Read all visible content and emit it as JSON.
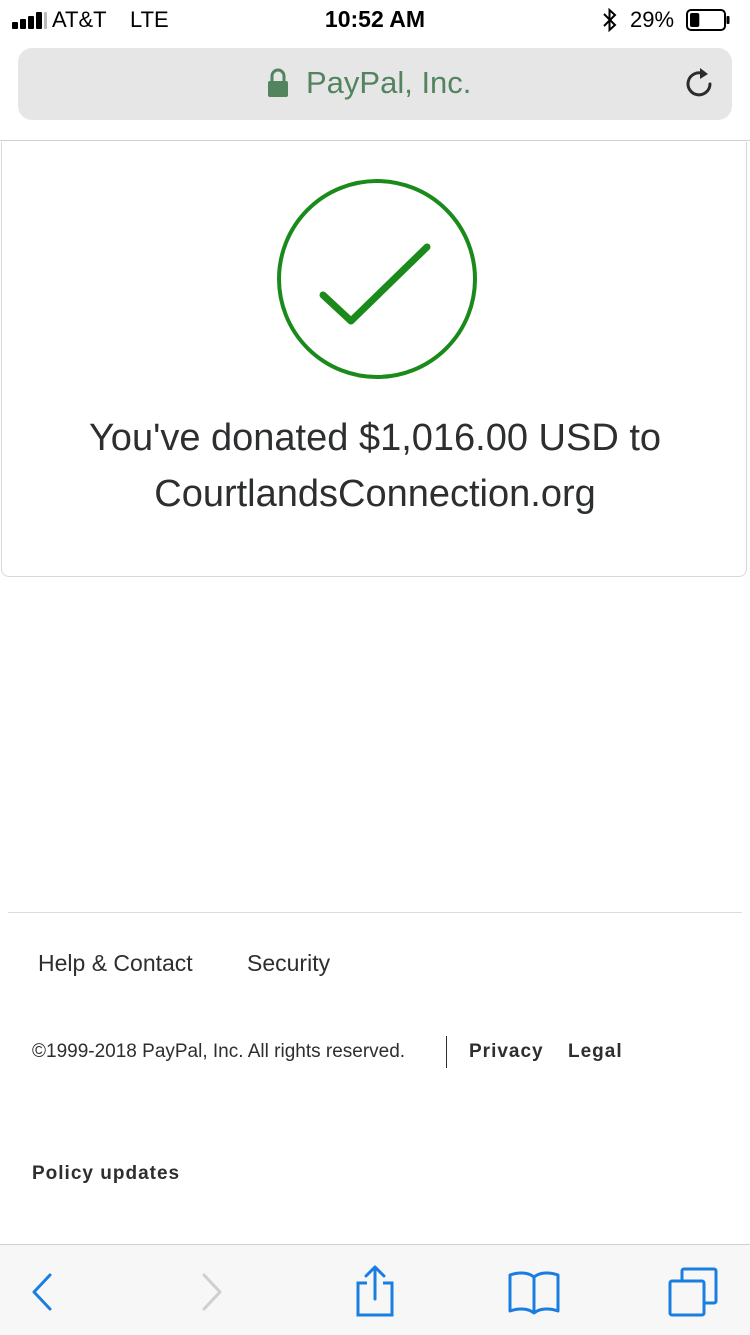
{
  "status_bar": {
    "carrier": "AT&T",
    "network": "LTE",
    "time": "10:52 AM",
    "battery_percent": "29%",
    "battery_level": 0.29
  },
  "url_bar": {
    "site_name": "PayPal, Inc.",
    "accent_color": "#52845f"
  },
  "confirmation": {
    "message_line1": "You've donated $1,016.00 USD to",
    "message_line2": "CourtlandsConnection.org",
    "success_color": "#1a8a1a"
  },
  "footer": {
    "help_label": "Help & Contact",
    "security_label": "Security",
    "copyright": "©1999-2018  PayPal, Inc. All rights reserved.",
    "privacy_label": "Privacy",
    "legal_label": "Legal",
    "policy_label": "Policy updates"
  },
  "toolbar": {
    "icons": [
      "back-icon",
      "forward-icon",
      "share-icon",
      "bookmarks-icon",
      "tabs-icon"
    ],
    "active_color": "#1a7ee0"
  }
}
